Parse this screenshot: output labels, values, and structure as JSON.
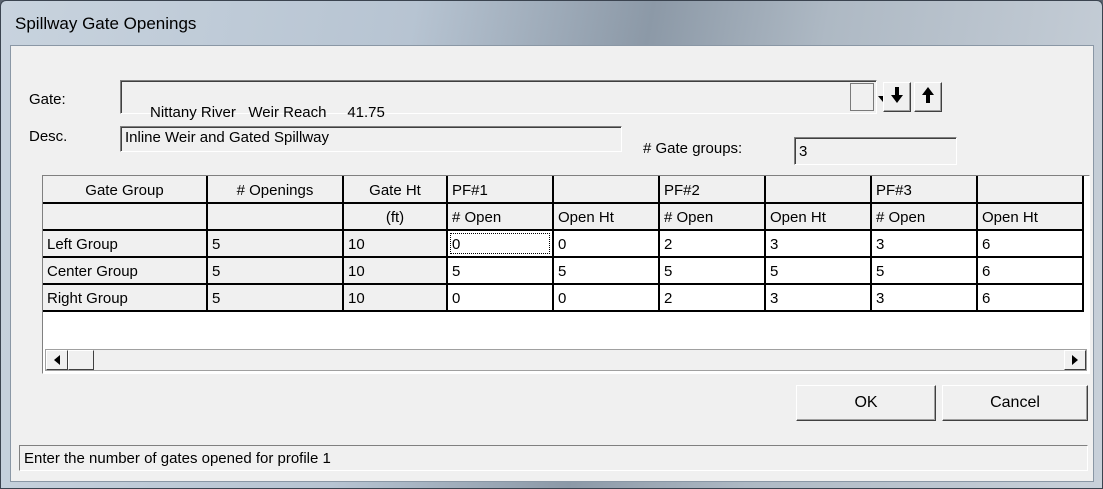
{
  "window": {
    "title": "Spillway Gate Openings"
  },
  "gate": {
    "label": "Gate:",
    "river": "Nittany River",
    "reach": "Weir Reach",
    "station": "41.75"
  },
  "desc": {
    "label": "Desc.",
    "value": "Inline Weir and Gated Spillway"
  },
  "gate_groups": {
    "label": "# Gate groups:",
    "value": "3"
  },
  "grid": {
    "header_row1": [
      "Gate Group",
      "# Openings",
      "Gate Ht",
      "PF#1",
      "",
      "PF#2",
      "",
      "PF#3",
      ""
    ],
    "header_row2": [
      "",
      "",
      "(ft)",
      "# Open",
      "Open Ht",
      "# Open",
      "Open Ht",
      "# Open",
      "Open Ht"
    ],
    "rows": [
      [
        "Left Group",
        "5",
        "10",
        "0",
        "0",
        "2",
        "3",
        "3",
        "6"
      ],
      [
        "Center Group",
        "5",
        "10",
        "5",
        "5",
        "5",
        "5",
        "5",
        "6"
      ],
      [
        "Right Group",
        "5",
        "10",
        "0",
        "0",
        "2",
        "3",
        "3",
        "6"
      ]
    ]
  },
  "buttons": {
    "ok": "OK",
    "cancel": "Cancel"
  },
  "status": {
    "text": "Enter the number of gates opened for profile 1"
  },
  "icons": {
    "dropdown": "chevron-down-icon",
    "move_down": "arrow-down-icon",
    "move_up": "arrow-up-icon",
    "scroll_left": "scroll-left-icon",
    "scroll_right": "scroll-right-icon"
  }
}
